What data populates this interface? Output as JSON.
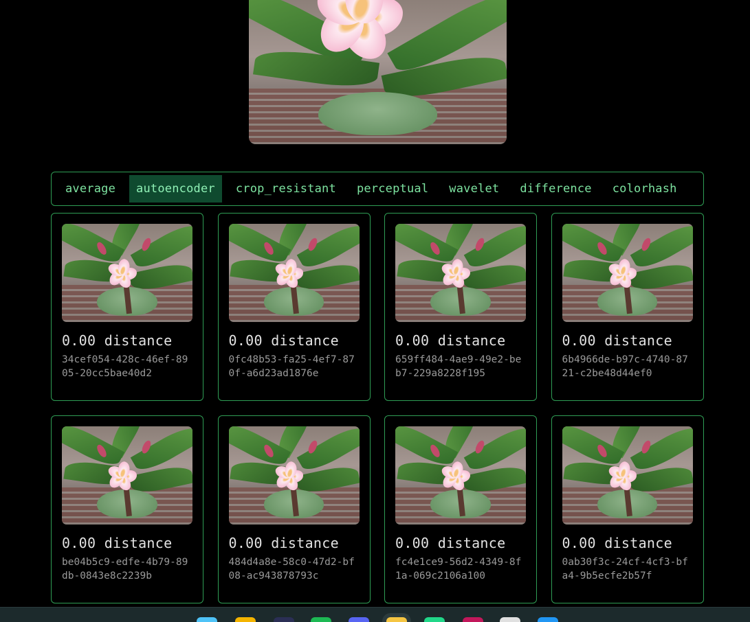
{
  "tabs": [
    {
      "label": "average",
      "active": false
    },
    {
      "label": "autoencoder",
      "active": true
    },
    {
      "label": "crop_resistant",
      "active": false
    },
    {
      "label": "perceptual",
      "active": false
    },
    {
      "label": "wavelet",
      "active": false
    },
    {
      "label": "difference",
      "active": false
    },
    {
      "label": "colorhash",
      "active": false
    }
  ],
  "results": [
    {
      "distance": "0.00 distance",
      "id": "34cef054-428c-46ef-8905-20cc5bae40d2"
    },
    {
      "distance": "0.00 distance",
      "id": "0fc48b53-fa25-4ef7-870f-a6d23ad1876e"
    },
    {
      "distance": "0.00 distance",
      "id": "659ff484-4ae9-49e2-beb7-229a8228f195"
    },
    {
      "distance": "0.00 distance",
      "id": "6b4966de-b97c-4740-8721-c2be48d44ef0"
    },
    {
      "distance": "0.00 distance",
      "id": "be04b5c9-edfe-4b79-89db-0843e8c2239b"
    },
    {
      "distance": "0.00 distance",
      "id": "484d4a8e-58c0-47d2-bf08-ac943878793c"
    },
    {
      "distance": "0.00 distance",
      "id": "fc4e1ce9-56d2-4349-8f1a-069c2106a100"
    },
    {
      "distance": "0.00 distance",
      "id": "0ab30f3c-24cf-4cf3-bfa4-9b5ecfe2b57f"
    }
  ],
  "taskbar": {
    "icons": [
      {
        "name": "windows-start-icon",
        "color": "#4fc3f7"
      },
      {
        "name": "file-explorer-icon",
        "color": "#f4b400"
      },
      {
        "name": "app-dark-icon",
        "color": "#2b2f55"
      },
      {
        "name": "spotify-icon",
        "color": "#1db954"
      },
      {
        "name": "discord-icon",
        "color": "#5865f2"
      },
      {
        "name": "active-app-icon",
        "color": "#f5c542"
      },
      {
        "name": "pycharm-icon",
        "color": "#21d789"
      },
      {
        "name": "jetbrains-icon",
        "color": "#c2185b"
      },
      {
        "name": "github-icon",
        "color": "#e0e0e0"
      },
      {
        "name": "browser-icon",
        "color": "#2196f3"
      }
    ]
  }
}
